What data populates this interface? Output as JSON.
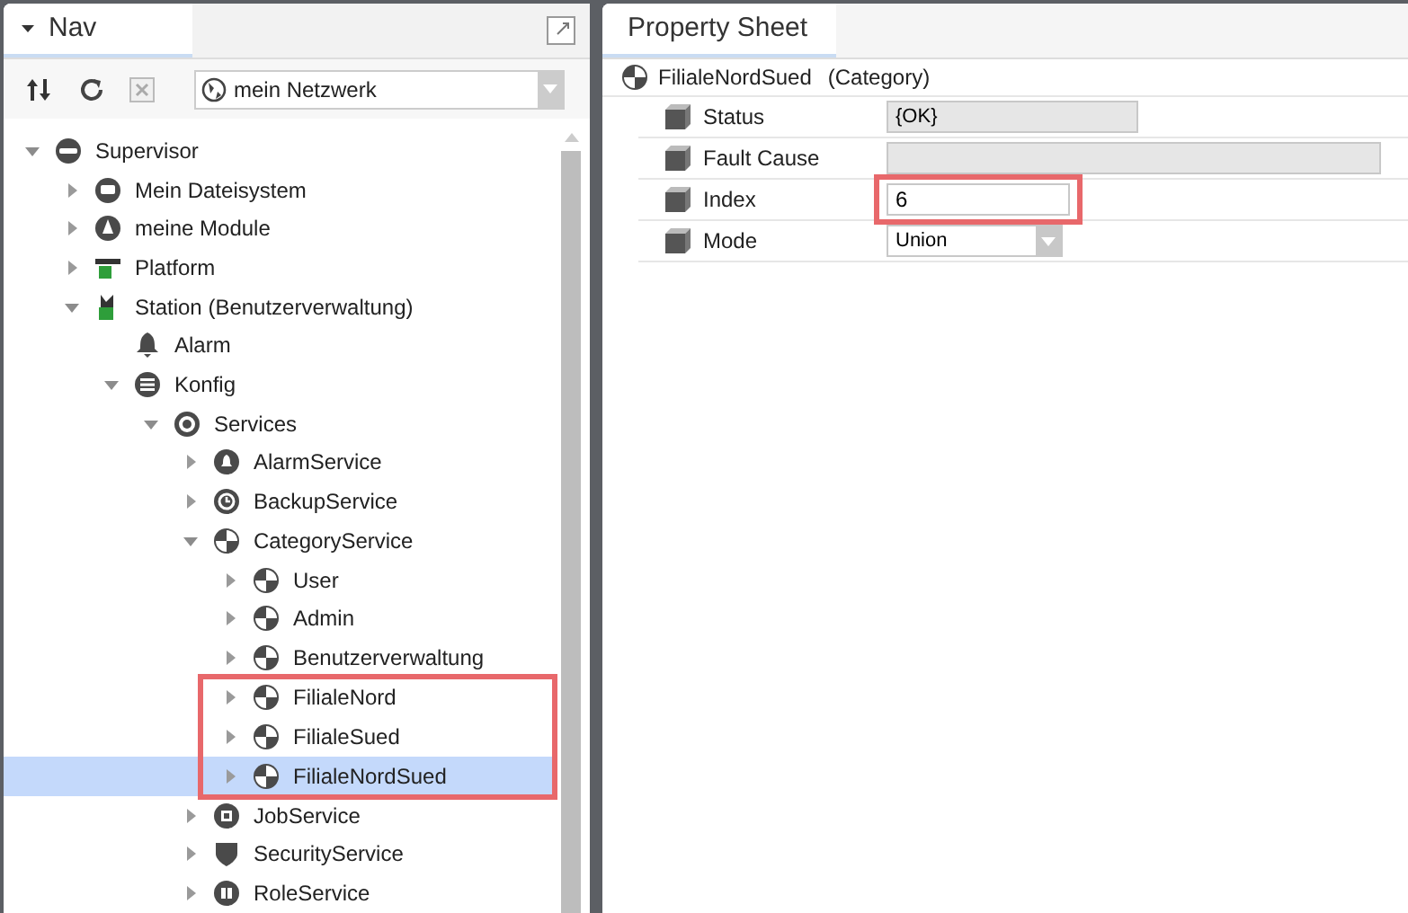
{
  "nav": {
    "title": "Nav",
    "network_select": {
      "value": "mein Netzwerk"
    },
    "tree": [
      {
        "label": "Supervisor",
        "kind": "server",
        "has_children": true,
        "expanded": true,
        "selected": false,
        "highlighted": false,
        "children": [
          {
            "label": "Mein Dateisystem",
            "kind": "drive",
            "has_children": true,
            "expanded": false,
            "selected": false,
            "highlighted": false
          },
          {
            "label": "meine Module",
            "kind": "module",
            "has_children": true,
            "expanded": false,
            "selected": false,
            "highlighted": false
          },
          {
            "label": "Platform",
            "kind": "platform",
            "has_children": true,
            "expanded": false,
            "selected": false,
            "highlighted": false
          },
          {
            "label": "Station (Benutzerverwaltung)",
            "kind": "station",
            "has_children": true,
            "expanded": true,
            "selected": false,
            "highlighted": false,
            "children": [
              {
                "label": "Alarm",
                "kind": "bell",
                "has_children": false,
                "expanded": false,
                "selected": false,
                "highlighted": false
              },
              {
                "label": "Konfig",
                "kind": "database",
                "has_children": true,
                "expanded": true,
                "selected": false,
                "highlighted": false,
                "children": [
                  {
                    "label": "Services",
                    "kind": "services",
                    "has_children": true,
                    "expanded": true,
                    "selected": false,
                    "highlighted": false,
                    "children": [
                      {
                        "label": "AlarmService",
                        "kind": "alarm",
                        "has_children": true,
                        "expanded": false,
                        "selected": false,
                        "highlighted": false
                      },
                      {
                        "label": "BackupService",
                        "kind": "backup",
                        "has_children": true,
                        "expanded": false,
                        "selected": false,
                        "highlighted": false
                      },
                      {
                        "label": "CategoryService",
                        "kind": "category",
                        "has_children": true,
                        "expanded": true,
                        "selected": false,
                        "highlighted": false,
                        "children": [
                          {
                            "label": "User",
                            "kind": "category",
                            "has_children": true,
                            "expanded": false,
                            "selected": false,
                            "highlighted": false
                          },
                          {
                            "label": "Admin",
                            "kind": "category",
                            "has_children": true,
                            "expanded": false,
                            "selected": false,
                            "highlighted": false
                          },
                          {
                            "label": "Benutzerverwaltung",
                            "kind": "category",
                            "has_children": true,
                            "expanded": false,
                            "selected": false,
                            "highlighted": false
                          },
                          {
                            "label": "FilialeNord",
                            "kind": "category",
                            "has_children": true,
                            "expanded": false,
                            "selected": false,
                            "highlighted": true
                          },
                          {
                            "label": "FilialeSued",
                            "kind": "category",
                            "has_children": true,
                            "expanded": false,
                            "selected": false,
                            "highlighted": true
                          },
                          {
                            "label": "FilialeNordSued",
                            "kind": "category",
                            "has_children": true,
                            "expanded": false,
                            "selected": true,
                            "highlighted": true
                          }
                        ]
                      },
                      {
                        "label": "JobService",
                        "kind": "job",
                        "has_children": true,
                        "expanded": false,
                        "selected": false,
                        "highlighted": false
                      },
                      {
                        "label": "SecurityService",
                        "kind": "shield",
                        "has_children": true,
                        "expanded": false,
                        "selected": false,
                        "highlighted": false
                      },
                      {
                        "label": "RoleService",
                        "kind": "role",
                        "has_children": true,
                        "expanded": false,
                        "selected": false,
                        "highlighted": false
                      }
                    ]
                  }
                ]
              }
            ]
          }
        ]
      }
    ]
  },
  "property_sheet": {
    "title": "Property Sheet",
    "object_name": "FilialeNordSued",
    "object_type": "(Category)",
    "rows": [
      {
        "label": "Status",
        "kind": "readonly",
        "value": "{OK}",
        "highlighted": false
      },
      {
        "label": "Fault Cause",
        "kind": "readonly_wide",
        "highlighted": false
      },
      {
        "label": "Index",
        "kind": "text",
        "value": "6",
        "highlighted": true
      },
      {
        "label": "Mode",
        "kind": "select",
        "value": "Union",
        "highlighted": false
      }
    ]
  }
}
